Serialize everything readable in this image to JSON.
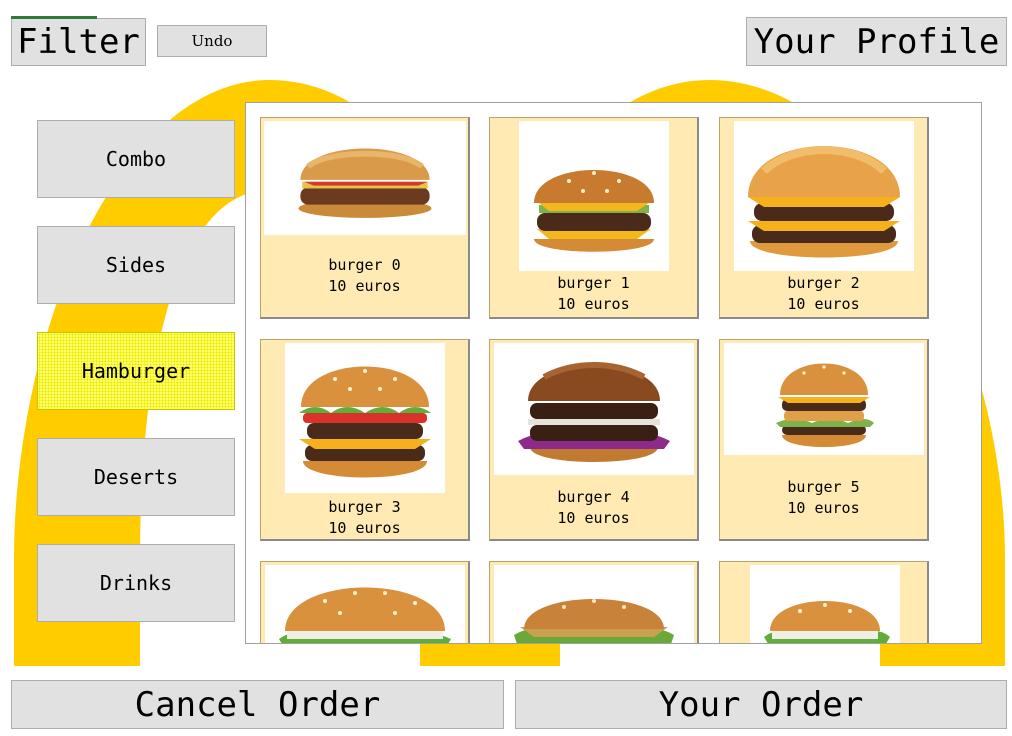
{
  "header": {
    "filter_label": "Filter",
    "undo_label": "Undo",
    "profile_label": "Your Profile"
  },
  "categories": [
    {
      "label": "Combo",
      "active": false
    },
    {
      "label": "Sides",
      "active": false
    },
    {
      "label": "Hamburger",
      "active": true
    },
    {
      "label": "Deserts",
      "active": false
    },
    {
      "label": "Drinks",
      "active": false
    }
  ],
  "products": [
    {
      "name": "burger 0",
      "price": "10 euros",
      "icon": "burger-image"
    },
    {
      "name": "burger 1",
      "price": "10 euros",
      "icon": "burger-image"
    },
    {
      "name": "burger 2",
      "price": "10 euros",
      "icon": "burger-image"
    },
    {
      "name": "burger 3",
      "price": "10 euros",
      "icon": "burger-image"
    },
    {
      "name": "burger 4",
      "price": "10 euros",
      "icon": "burger-image"
    },
    {
      "name": "burger 5",
      "price": "10 euros",
      "icon": "burger-image"
    },
    {
      "name": "",
      "price": "",
      "icon": "burger-image"
    },
    {
      "name": "",
      "price": "",
      "icon": "burger-image"
    },
    {
      "name": "",
      "price": "",
      "icon": "burger-image"
    }
  ],
  "footer": {
    "cancel_label": "Cancel Order",
    "order_label": "Your Order"
  },
  "colors": {
    "arch": "#ffcc00",
    "card": "#ffeab3",
    "button": "#e1e1e1",
    "active_category": "#ffff66"
  }
}
